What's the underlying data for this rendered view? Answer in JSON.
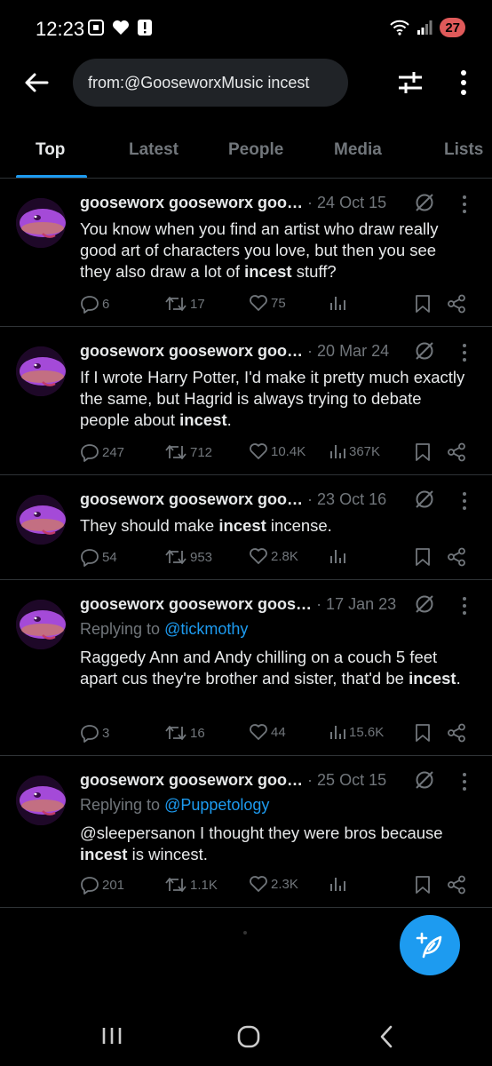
{
  "status_bar": {
    "time": "12:23",
    "battery": "27",
    "icons_left": [
      "screenshot-icon",
      "heart-icon",
      "alert-icon"
    ],
    "icons_right": [
      "wifi-icon",
      "signal-icon",
      "battery-icon"
    ]
  },
  "header": {
    "search_query": "from:@GooseworxMusic incest"
  },
  "tabs": [
    {
      "label": "Top"
    },
    {
      "label": "Latest"
    },
    {
      "label": "People"
    },
    {
      "label": "Media"
    },
    {
      "label": "Lists"
    }
  ],
  "tweets": [
    {
      "name": "gooseworx gooseworx goo…",
      "date": "· 24 Oct 15",
      "reply_prefix": "",
      "reply_handle": "",
      "text_parts": [
        {
          "t": "You know when you find an artist who draw really good art of characters you love, but then you see they also draw a lot of ",
          "b": false
        },
        {
          "t": "incest",
          "b": true
        },
        {
          "t": " stuff?",
          "b": false
        }
      ],
      "replies": "6",
      "reposts": "17",
      "likes": "75",
      "views": ""
    },
    {
      "name": "gooseworx gooseworx goo…",
      "date": "· 20 Mar 24",
      "reply_prefix": "",
      "reply_handle": "",
      "text_parts": [
        {
          "t": "If I wrote Harry Potter, I'd make it pretty much exactly the same, but Hagrid is always trying to debate people about ",
          "b": false
        },
        {
          "t": "incest",
          "b": true
        },
        {
          "t": ".",
          "b": false
        }
      ],
      "replies": "247",
      "reposts": "712",
      "likes": "10.4K",
      "views": "367K"
    },
    {
      "name": "gooseworx gooseworx goo…",
      "date": "· 23 Oct 16",
      "reply_prefix": "",
      "reply_handle": "",
      "text_parts": [
        {
          "t": "They should make ",
          "b": false
        },
        {
          "t": "incest",
          "b": true
        },
        {
          "t": " incense.",
          "b": false
        }
      ],
      "replies": "54",
      "reposts": "953",
      "likes": "2.8K",
      "views": ""
    },
    {
      "name": "gooseworx gooseworx goos…",
      "date": "· 17 Jan 23",
      "reply_prefix": "Replying to ",
      "reply_handle": "@tickmothy",
      "text_parts": [
        {
          "t": "Raggedy Ann and Andy chilling on a couch 5 feet apart cus they're brother and sister, that'd be ",
          "b": false
        },
        {
          "t": "incest",
          "b": true
        },
        {
          "t": ".",
          "b": false
        }
      ],
      "replies": "3",
      "reposts": "16",
      "likes": "44",
      "views": "15.6K"
    },
    {
      "name": "gooseworx gooseworx goo…",
      "date": "· 25 Oct 15",
      "reply_prefix": "Replying to ",
      "reply_handle": "@Puppetology",
      "text_parts": [
        {
          "t": "@sleepersanon I thought they were bros because ",
          "b": false
        },
        {
          "t": "incest",
          "b": true
        },
        {
          "t": " is wincest.",
          "b": false
        }
      ],
      "replies": "201",
      "reposts": "1.1K",
      "likes": "2.3K",
      "views": ""
    }
  ],
  "colors": {
    "background": "#000000",
    "accent": "#1d9bf0",
    "text": "#e7e9ea",
    "muted": "#71767b",
    "divider": "#2f3336"
  }
}
